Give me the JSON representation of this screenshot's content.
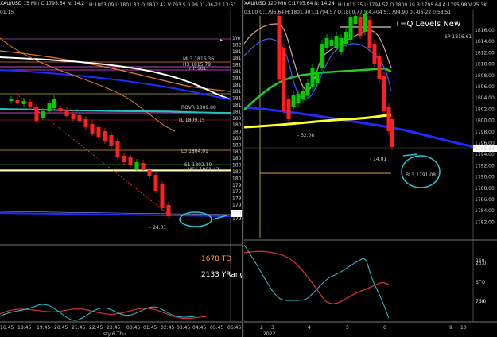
{
  "left_chart": {
    "symbol": "XAU/USD",
    "header": " 15 Min  C:1795.64  N: 14.2",
    "header_right": "H:1803.09  L:1801.33  O:1802.42  V:793  S 0.99  01-06-22  13:51",
    "header_left_cut": "01.15",
    "price_axis": [
      "1Ye",
      "1820",
      "1819",
      "1818",
      "1817",
      "1816",
      "1815",
      "1814",
      "1813",
      "1812",
      "1811",
      "1810",
      "1809",
      "1808",
      "1807",
      "1806",
      "1805",
      "1804",
      "1803",
      "1802",
      "1801",
      "1800",
      "1799",
      "1798",
      "1797",
      "1796",
      "1795",
      "1794"
    ],
    "current_price": "1795",
    "levels": [
      {
        "label": "ML3 1816.36",
        "color": "#e07a2c"
      },
      {
        "label": "H3 1815.79",
        "color": "#ff66ff"
      },
      {
        "label": "HP 181",
        "color": "#ff44ff"
      },
      {
        "label": "ROVR 1809.88",
        "color": "#ffff66"
      },
      {
        "label": "TL 1809.15",
        "color": "#cc3333"
      },
      {
        "label": "L3 1804.01",
        "color": "#e0a030"
      },
      {
        "label": "S1 1802.19",
        "color": "#33cc33"
      },
      {
        "label": "MS1 1801.43",
        "color": "#dddddd"
      },
      {
        "label": "- 24.01",
        "color": "#ff4444"
      }
    ],
    "indicator_texts": [
      {
        "text": "1678 TD",
        "color": "#ff9933"
      },
      {
        "text": "2133 YRange",
        "color": "#ffffff"
      }
    ],
    "x_axis": [
      "16:45",
      "18:45",
      "19:45",
      "20:45",
      "21:45",
      "22:45",
      "23:45",
      "00:45",
      "01:45",
      "02:45",
      "03:45",
      "04:45",
      "05:45",
      "06:45"
    ],
    "x_footer": "sty 6 Thu",
    "colors": {
      "bull": "#1fd11f",
      "bull_body": "#00cc00",
      "bear": "#ff2020",
      "ma_blue": "#1e2cff",
      "ma_white": "#ffffff",
      "ma_orange": "#e07a2c",
      "annot": "#29c4d6"
    }
  },
  "right_chart": {
    "symbol": "XAU/USD",
    "header": " 120 Min  C:1795.64  N: 14.24",
    "header_right": "H:1811.35  L:1794.57  O:1809.19  B:1795.64  A:1795.98  V:25.3K",
    "header_line2": "03.00  C:1795.64  H:1801.90  L:1794.57  O:1800.77  V:4,404  S:1794.90  01-06-22  0:58:51",
    "title": "T=Q Levels New",
    "price_axis": [
      "1816.00",
      "1814.00",
      "1812.00",
      "1810.00",
      "1808.00",
      "1806.00",
      "1804.00",
      "1802.00",
      "1800.00",
      "1798.00",
      "1796.00",
      "1794.00",
      "1792.00",
      "1790.00",
      "1788.00",
      "1786.00",
      "1784.00",
      "1782.00"
    ],
    "current_price": "1795.64",
    "levels": [
      {
        "label": "- SP 1816.61",
        "color": "#ffffff"
      },
      {
        "label": "- 32.08",
        "color": "#ff4444"
      },
      {
        "label": "- 14.01",
        "color": "#ff4444"
      },
      {
        "label": "BL3 1791.08",
        "color": "#e0a030"
      }
    ],
    "osc_axis": [
      "250",
      "25.0",
      "STO",
      "75.0",
      "750"
    ],
    "x_axis": [
      "2",
      "3",
      "4",
      "5",
      "6",
      "9",
      "10"
    ],
    "x_footer": "2022"
  }
}
